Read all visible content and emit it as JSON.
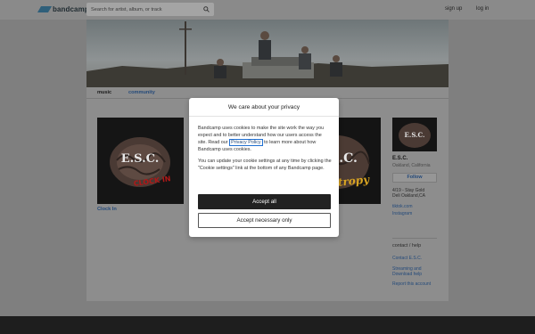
{
  "topbar": {
    "logo_text": "bandcamp",
    "search_placeholder": "Search for artist, album, or track",
    "signup_label": "sign up",
    "login_label": "log in"
  },
  "tabs": {
    "music": "music",
    "community": "community"
  },
  "albums": [
    {
      "title": "Clock In",
      "art_text": "E.S.C.",
      "art_subtext": "CLOCK IN"
    },
    {
      "title": "",
      "art_text": "E.S.C.",
      "art_subtext": "Entropy"
    }
  ],
  "sidebar": {
    "photo_text": "E.S.C.",
    "band_name": "E.S.C.",
    "location": "Oakland, California",
    "follow_label": "Follow",
    "show_line1": "4/19 - Stay Gold",
    "show_line2": "Deli Oakland,CA",
    "link_tiktok": "tiktok.com",
    "link_instagram": "Instagram",
    "contact_heading": "contact / help",
    "contact_link": "Contact E.S.C.",
    "streaming_line1": "Streaming and",
    "streaming_line2": "Download help",
    "report_link": "Report this account"
  },
  "modal": {
    "title": "We care about your privacy",
    "p1_before": "Bandcamp uses cookies to make the site work the way you expect and to better understand how our users access the site. Read our ",
    "p1_link": "Privacy Policy",
    "p1_after": " to learn more about how Bandcamp uses cookies.",
    "p2": "You can update your cookie settings at any time by clicking the \"Cookie settings\" link at the bottom of any Bandcamp page.",
    "accept_all_label": "Accept all",
    "accept_necessary_label": "Accept necessary only"
  },
  "colors": {
    "link": "#244a7a",
    "overlay": "#7f7f7f",
    "button_dark": "#222222",
    "logo": "#2f5f7a"
  }
}
